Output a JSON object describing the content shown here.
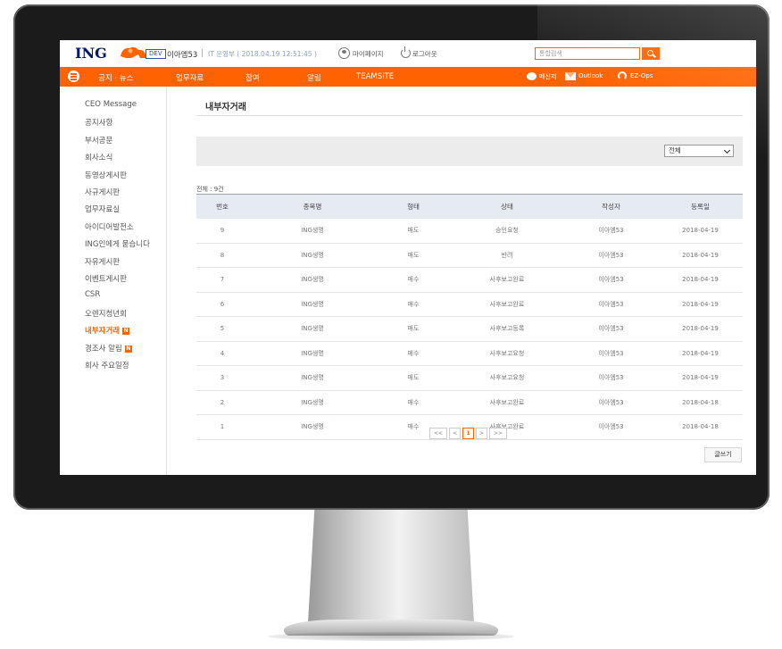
{
  "header": {
    "logo": "ING",
    "env_badge": "DEV",
    "user_name": "이아엠53",
    "separator": "|",
    "dept": "IT 운영부 ( 2018.04.19 12:51:45 )",
    "mypage_label": "마이페이지",
    "logout_label": "로그아웃",
    "search_placeholder": "통합검색"
  },
  "nav": {
    "items": [
      "공지 · 뉴스",
      "업무자료",
      "참여",
      "알림",
      "TEAMSITE"
    ],
    "right": [
      "메신저",
      "Outlook",
      "EZ-Ops"
    ]
  },
  "sidebar": {
    "items": [
      {
        "label": "CEO Message",
        "active": false,
        "new": false
      },
      {
        "label": "공지사항",
        "active": false,
        "new": false
      },
      {
        "label": "부서공문",
        "active": false,
        "new": false
      },
      {
        "label": "회사소식",
        "active": false,
        "new": false
      },
      {
        "label": "동영상게시판",
        "active": false,
        "new": false
      },
      {
        "label": "사규게시판",
        "active": false,
        "new": false
      },
      {
        "label": "업무자료실",
        "active": false,
        "new": false
      },
      {
        "label": "아이디어발전소",
        "active": false,
        "new": false
      },
      {
        "label": "ING인에게 묻습니다",
        "active": false,
        "new": false
      },
      {
        "label": "자유게시판",
        "active": false,
        "new": false
      },
      {
        "label": "이벤트게시판",
        "active": false,
        "new": false
      },
      {
        "label": "CSR",
        "active": false,
        "new": false
      },
      {
        "label": "오렌지청년회",
        "active": false,
        "new": false
      },
      {
        "label": "내부자거래",
        "active": true,
        "new": true
      },
      {
        "label": "경조사 알림",
        "active": false,
        "new": true
      },
      {
        "label": "회사 주요일정",
        "active": false,
        "new": false
      }
    ],
    "new_badge": "N"
  },
  "main": {
    "title": "내부자거래",
    "filter_value": "전체",
    "total": "전체 : 9건",
    "columns": [
      "번호",
      "종목명",
      "형태",
      "상태",
      "작성자",
      "등록일"
    ],
    "rows": [
      [
        "9",
        "ING생명",
        "매도",
        "승인요청",
        "이아엠53",
        "2018-04-19"
      ],
      [
        "8",
        "ING생명",
        "매도",
        "반려",
        "이아엠53",
        "2018-04-19"
      ],
      [
        "7",
        "ING생명",
        "매수",
        "사후보고완료",
        "이아엠53",
        "2018-04-19"
      ],
      [
        "6",
        "ING생명",
        "매수",
        "사후보고완료",
        "이아엠53",
        "2018-04-19"
      ],
      [
        "5",
        "ING생명",
        "매도",
        "사후보고등록",
        "이아엠53",
        "2018-04-19"
      ],
      [
        "4",
        "ING생명",
        "매수",
        "사후보고요청",
        "이아엠53",
        "2018-04-19"
      ],
      [
        "3",
        "ING생명",
        "매도",
        "사후보고요청",
        "이아엠53",
        "2018-04-19"
      ],
      [
        "2",
        "ING생명",
        "매수",
        "사후보고완료",
        "이아엠53",
        "2018-04-18"
      ],
      [
        "1",
        "ING생명",
        "매수",
        "사후보고완료",
        "이아엠53",
        "2018-04-18"
      ]
    ],
    "pager": {
      "first": "<<",
      "prev": "<",
      "current": "1",
      "next": ">",
      "last": ">>"
    },
    "write_button": "글쓰기"
  },
  "colors": {
    "brand_orange": "#ff6200",
    "brand_navy": "#00196e"
  }
}
